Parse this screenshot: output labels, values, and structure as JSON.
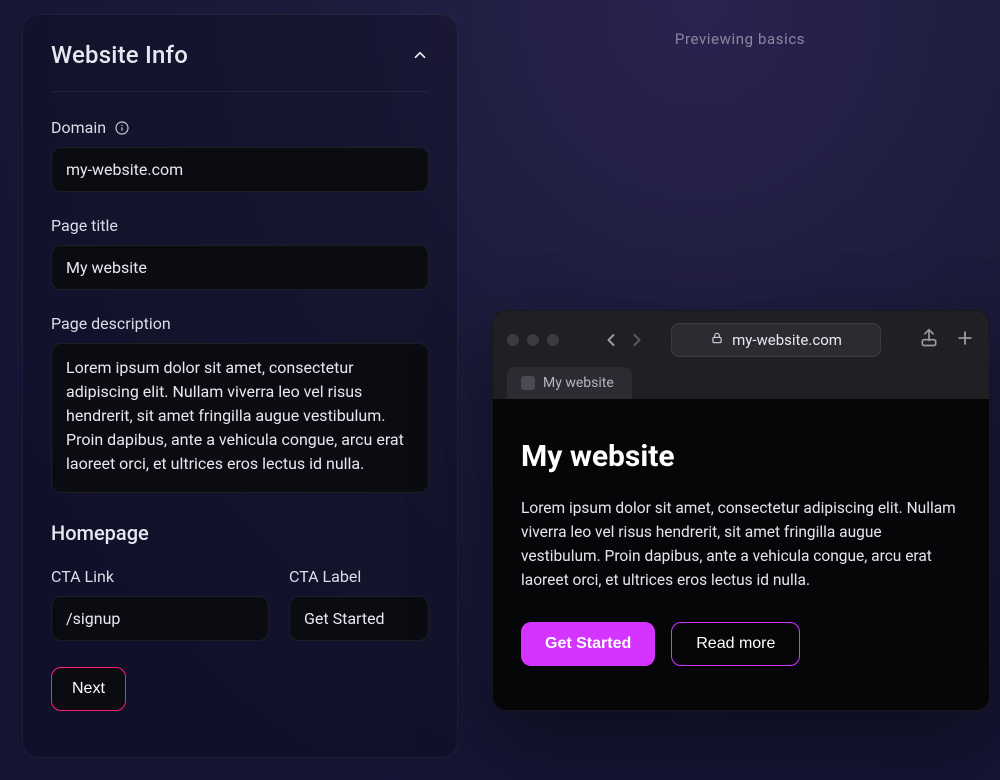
{
  "panel": {
    "title": "Website Info",
    "domain": {
      "label": "Domain",
      "value": "my-website.com"
    },
    "page_title": {
      "label": "Page title",
      "value": "My website"
    },
    "description": {
      "label": "Page description",
      "value": "Lorem ipsum dolor sit amet, consectetur adipiscing elit. Nullam viverra leo vel risus hendrerit, sit amet fringilla augue vestibulum. Proin dapibus, ante a vehicula congue, arcu erat laoreet orci, et ultrices eros lectus id nulla."
    },
    "homepage": {
      "title": "Homepage",
      "cta_link": {
        "label": "CTA Link",
        "value": "/signup"
      },
      "cta_label": {
        "label": "CTA Label",
        "value": "Get Started"
      }
    },
    "next_label": "Next"
  },
  "preview": {
    "label": "Previewing basics",
    "url": "my-website.com",
    "tab_title": "My website",
    "page": {
      "heading": "My website",
      "body": "Lorem ipsum dolor sit amet, consectetur adipiscing elit. Nullam viverra leo vel risus hendrerit, sit amet fringilla augue vestibulum. Proin dapibus, ante a vehicula congue, arcu erat laoreet orci, et ultrices eros lectus id nulla.",
      "cta_primary": "Get Started",
      "cta_secondary": "Read more"
    }
  },
  "icons": {
    "chevron_up": "chevron-up-icon",
    "info": "info-icon",
    "lock": "lock-icon",
    "share": "share-icon",
    "plus": "plus-icon",
    "nav_back": "nav-back-icon",
    "nav_forward": "nav-forward-icon"
  },
  "colors": {
    "accent_pink": "#ff1d7a",
    "accent_magenta": "#d533ff",
    "bg_input": "#0b0b12"
  }
}
